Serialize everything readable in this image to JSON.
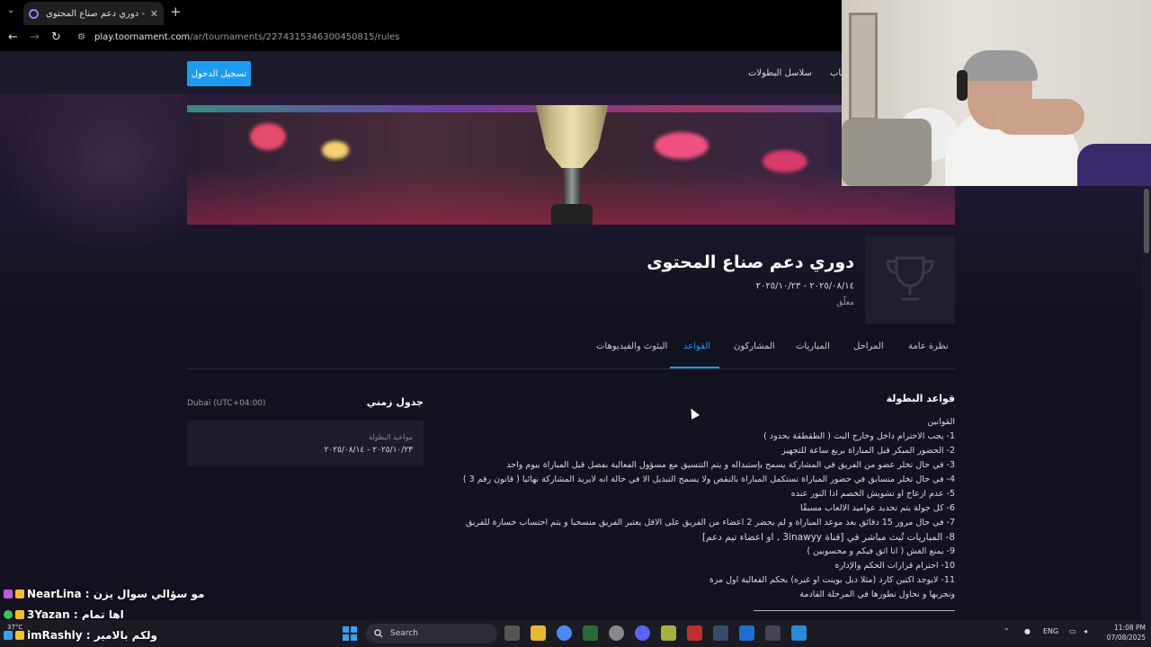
{
  "browser": {
    "tab_title": "دوري دعم صناع المحتوى - Rules",
    "tab_close": "✕",
    "new_tab": "+",
    "tab_menu": "⌄",
    "url_host": "play.toornament.com",
    "url_path": "/ar/tournaments/227431534630045081​5/rules",
    "nav_back": "←",
    "nav_forward": "→",
    "nav_reload": "↻",
    "site_settings": "⚙"
  },
  "header": {
    "login_label": "تسجيل الدخول",
    "nav_series": "سلاسل البطولات",
    "nav_games": "ألعاب"
  },
  "tournament": {
    "title": "دوري دعم صناع المحتوى",
    "dates": "٢٠٢٥/٠٨/١٤ - ٢٠٢٥/١٠/٢٣",
    "status": "معلّق"
  },
  "tabs": [
    {
      "label": "نظرة عامة"
    },
    {
      "label": "المراحل"
    },
    {
      "label": "المباريات"
    },
    {
      "label": "المشاركون"
    },
    {
      "label": "القواعد"
    },
    {
      "label": "البثوث والفيديوهات"
    }
  ],
  "schedule": {
    "title": "جدول زمني",
    "timezone": "Dubai (UTC+04:00)",
    "label": "مواعيد البطولة",
    "dates": "٢٠٢٥/١٠/٢٣ - ٢٠٢٥/٠٨/١٤"
  },
  "rules": {
    "title": "قواعد البطولة",
    "lines": [
      "القوانين",
      "1- يجب الاحترام داخل وخارج البث ( الطقطقة بحدود )",
      "2- الحضور المبكر قبل المباراة بربع ساعة للتجهيز",
      "3- في حال تخلر عضو من الفريق في المشاركة يسمح بإستبداله و يتم التنسيق مع مسؤول الفعالية بفصل قبل المباراة بيوم واحد",
      "4- في حال تخلر متسابق في حضور المباراة تستكمل المباراة بالنقص ولا يسمح التبديل الا في حالة انه لايريد المشاركة نهائيا ( قانون رقم 3 )",
      "5- عدم ازعاج او تشويش الخصم اذا النور عنده",
      "6- كل جولة يتم تحديد عواميد الالعاب مسبقًا",
      "7- في حال مرور 15 دقائق بعد موعد المباراة و لم يحضر 2 اعضاء من الفريق على الاقل يعتبر الفريق منسحبا و يتم احتساب خسارة للفريق",
      "8- المباريات تُبث مباشر في [قناة 3inawyy , او اعضاء تيم دعم]",
      "9- يمنع الغش ( انا اثق فيكم و محسوبين )",
      "10- احترام قرارات الحكم والإدارة",
      "11- لايوجد اكتين كارد (مثلا دبل بوينت او غيره) بحكم الفعالية اول مرة",
      "ونجربها و نحاول نطورها في المرحلة القادمة"
    ]
  },
  "chat": [
    {
      "user": "NearLina",
      "message": "مو سؤالي سوال يزن",
      "color": "#c05ad8"
    },
    {
      "user": "3Yazan",
      "message": "اها تمام",
      "color": "#3cc060"
    },
    {
      "user": "imRashly",
      "message": "ولكم بالامير",
      "color": "#3aa0f0"
    }
  ],
  "taskbar": {
    "search_label": "Search",
    "weather": "37°C",
    "language": "ENG",
    "time": "11:08 PM",
    "date": "07/08/2025"
  },
  "colors": {
    "accent": "#1d9bf0",
    "page_bg": "#13121f",
    "header_bg": "#1c1b2b"
  }
}
